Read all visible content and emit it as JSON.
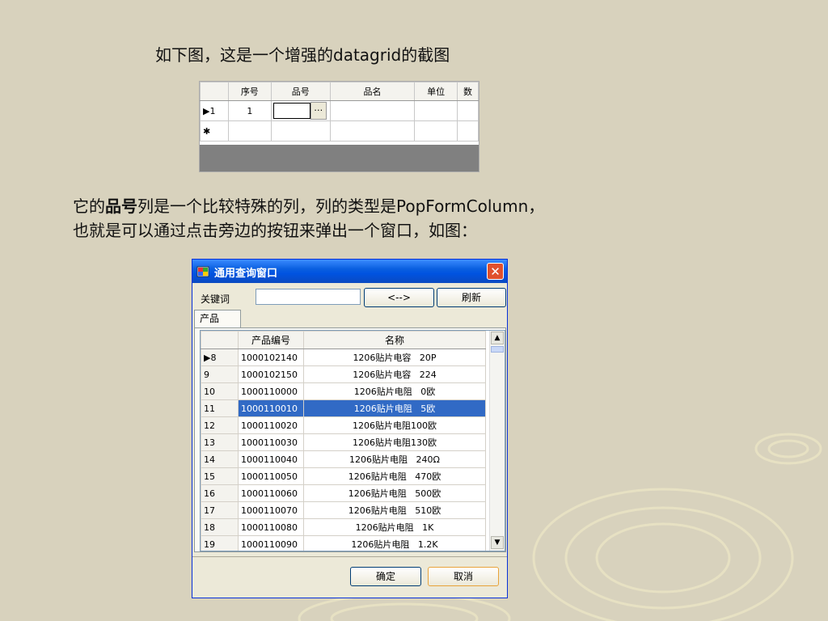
{
  "slide": {
    "line1": "如下图，这是一个增强的datagrid的截图",
    "para2_pre": "它的",
    "para2_bold": "品号",
    "para2_post": "列是一个比较特殊的列，列的类型是PopFormColumn，",
    "para3": "也就是可以通过点击旁边的按钮来弹出一个窗口，如图："
  },
  "grid1": {
    "headers": [
      "",
      "序号",
      "品号",
      "品名",
      "单位",
      "数"
    ],
    "row1_indicator": "▶1",
    "row1_seq": "1",
    "row1_button": "…",
    "new_row_indicator": "✱"
  },
  "dialog": {
    "title": "通用查询窗口",
    "close_label": "✕",
    "keyword_label": "关键词",
    "keyword_value": "",
    "nav_button": "<-->",
    "refresh_button": "刷新",
    "tab_label": "产品",
    "ok_button": "确定",
    "cancel_button": "取消"
  },
  "grid2": {
    "headers": [
      "",
      "产品编号",
      "名称"
    ],
    "rows": [
      {
        "rh": "▶8",
        "code": "1000102140",
        "name": "1206贴片电容   20P"
      },
      {
        "rh": "9",
        "code": "1000102150",
        "name": "1206贴片电容   224"
      },
      {
        "rh": "10",
        "code": "1000110000",
        "name": "1206贴片电阻   0欧"
      },
      {
        "rh": "11",
        "code": "1000110010",
        "name": "1206贴片电阻   5欧"
      },
      {
        "rh": "12",
        "code": "1000110020",
        "name": "1206贴片电阻100欧"
      },
      {
        "rh": "13",
        "code": "1000110030",
        "name": "1206贴片电阻130欧"
      },
      {
        "rh": "14",
        "code": "1000110040",
        "name": "1206贴片电阻   240Ω"
      },
      {
        "rh": "15",
        "code": "1000110050",
        "name": "1206贴片电阻   470欧"
      },
      {
        "rh": "16",
        "code": "1000110060",
        "name": "1206贴片电阻   500欧"
      },
      {
        "rh": "17",
        "code": "1000110070",
        "name": "1206贴片电阻   510欧"
      },
      {
        "rh": "18",
        "code": "1000110080",
        "name": "1206贴片电阻   1K"
      },
      {
        "rh": "19",
        "code": "1000110090",
        "name": "1206贴片电阻   1.2K"
      }
    ],
    "selected_index": 3
  }
}
